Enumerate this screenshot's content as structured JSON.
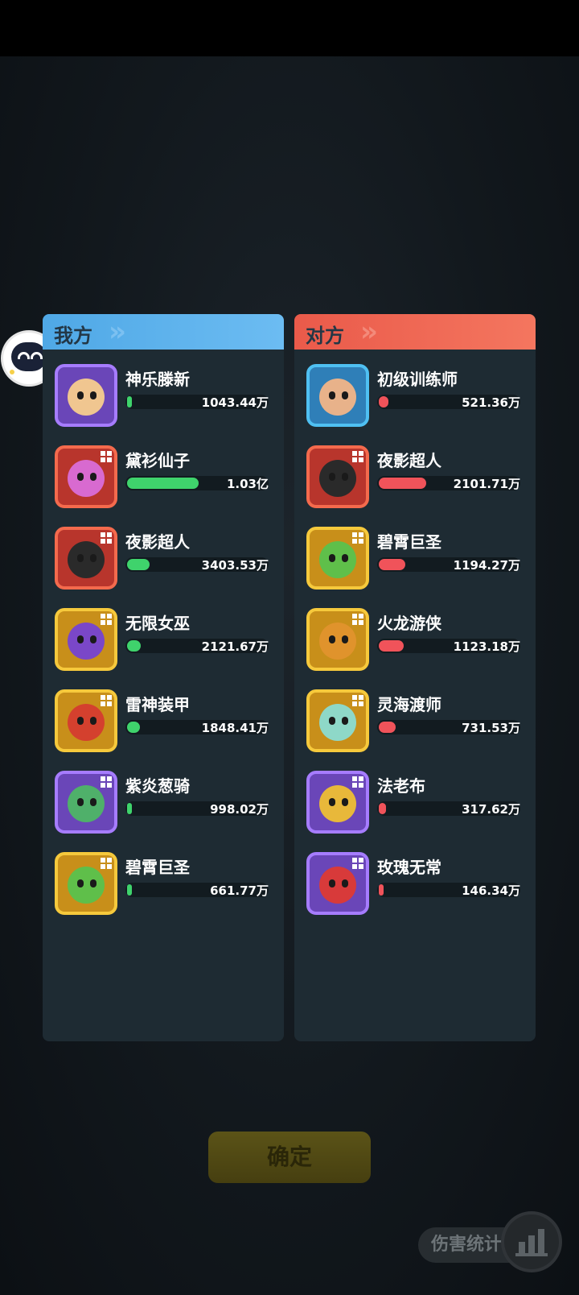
{
  "left_panel": {
    "title": "我方",
    "rows": [
      {
        "name": "神乐滕新",
        "value": "1043.44万",
        "fill": 0.03,
        "quality": "purple",
        "tone": "#f0c690",
        "marker": "none"
      },
      {
        "name": "黛衫仙子",
        "value": "1.03亿",
        "fill": 0.51,
        "quality": "red",
        "tone": "#d86ad0",
        "marker": "grid"
      },
      {
        "name": "夜影超人",
        "value": "3403.53万",
        "fill": 0.16,
        "quality": "red",
        "tone": "#2a2a2a",
        "marker": "grid"
      },
      {
        "name": "无限女巫",
        "value": "2121.67万",
        "fill": 0.1,
        "quality": "gold",
        "tone": "#7a47c8",
        "marker": "grid"
      },
      {
        "name": "雷神装甲",
        "value": "1848.41万",
        "fill": 0.09,
        "quality": "gold",
        "tone": "#d4402e",
        "marker": "grid"
      },
      {
        "name": "紫炎葱骑",
        "value": "998.02万",
        "fill": 0.03,
        "quality": "purple",
        "tone": "#4fb06a",
        "marker": "grid"
      },
      {
        "name": "碧霄巨圣",
        "value": "661.77万",
        "fill": 0.02,
        "quality": "gold",
        "tone": "#5fbf4a",
        "marker": "grid"
      }
    ]
  },
  "right_panel": {
    "title": "对方",
    "rows": [
      {
        "name": "初级训练师",
        "value": "521.36万",
        "fill": 0.07,
        "quality": "blue",
        "tone": "#e8b28a",
        "marker": "none"
      },
      {
        "name": "夜影超人",
        "value": "2101.71万",
        "fill": 0.34,
        "quality": "red",
        "tone": "#2a2a2a",
        "marker": "grid"
      },
      {
        "name": "碧霄巨圣",
        "value": "1194.27万",
        "fill": 0.19,
        "quality": "gold",
        "tone": "#5fbf4a",
        "marker": "grid"
      },
      {
        "name": "火龙游侠",
        "value": "1123.18万",
        "fill": 0.18,
        "quality": "gold",
        "tone": "#e0932c",
        "marker": "grid"
      },
      {
        "name": "灵海渡师",
        "value": "731.53万",
        "fill": 0.12,
        "quality": "gold",
        "tone": "#8ed8c8",
        "marker": "grid"
      },
      {
        "name": "法老布",
        "value": "317.62万",
        "fill": 0.05,
        "quality": "purple",
        "tone": "#e8b83a",
        "marker": "grid"
      },
      {
        "name": "玫瑰无常",
        "value": "146.34万",
        "fill": 0.02,
        "quality": "purple",
        "tone": "#d83a3a",
        "marker": "grid"
      }
    ]
  },
  "confirm_label": "确定",
  "damage_stats_label": "伤害统计",
  "colors": {
    "ally_accent": "#4fa8e6",
    "enemy_accent": "#ea5a4a",
    "ally_bar": "#3fd36c",
    "enemy_bar": "#f0535a"
  },
  "icons": {
    "assistant": "robot-icon",
    "damage_stats": "bar-chart-icon",
    "hero_tag": "grid-icon"
  }
}
